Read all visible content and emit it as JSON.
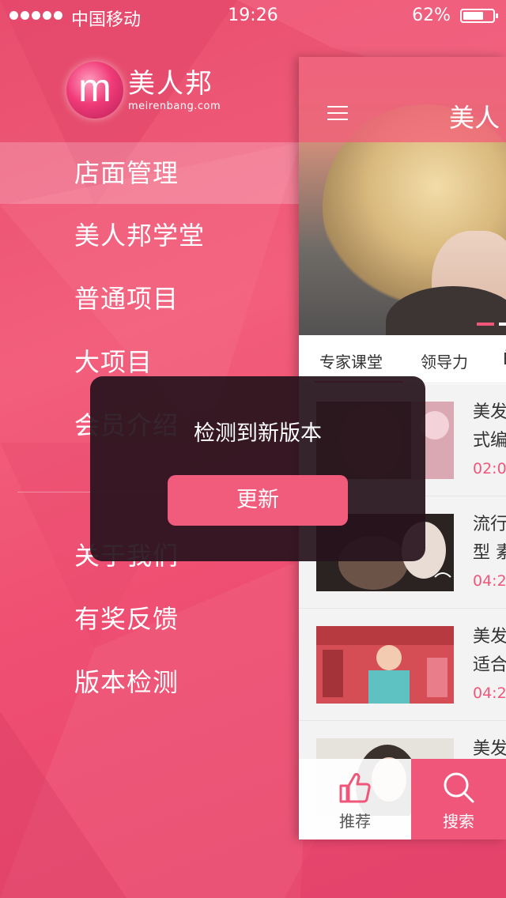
{
  "status_bar": {
    "carrier": "中国移动",
    "time": "19:26",
    "battery": "62%"
  },
  "brand": {
    "mark": "m",
    "name_cn": "美人邦",
    "name_en": "meirenbang.com"
  },
  "menu": {
    "items": [
      {
        "label": "店面管理",
        "active": true
      },
      {
        "label": "美人邦学堂"
      },
      {
        "label": "普通项目"
      },
      {
        "label": "大项目"
      },
      {
        "label": "会员介绍"
      }
    ],
    "items2": [
      {
        "label": "关于我们"
      },
      {
        "label": "有奖反馈"
      },
      {
        "label": "版本检测"
      }
    ]
  },
  "app": {
    "title": "美人",
    "tabs": [
      {
        "label": "专家课堂"
      },
      {
        "label": "领导力"
      },
      {
        "label": "Ē"
      }
    ],
    "list": [
      {
        "title_l1": "美发",
        "title_l2": "式编",
        "time": "02:0"
      },
      {
        "title_l1": "流行",
        "title_l2": "型 素",
        "time": "04:2"
      },
      {
        "title_l1": "美发",
        "title_l2": "适合",
        "time": "04:2"
      },
      {
        "title_l1": "美发",
        "title_l2": "",
        "time": ""
      }
    ],
    "nav": {
      "recommend": "推荐",
      "search": "搜索"
    }
  },
  "dialog": {
    "message": "检测到新版本",
    "button": "更新"
  }
}
